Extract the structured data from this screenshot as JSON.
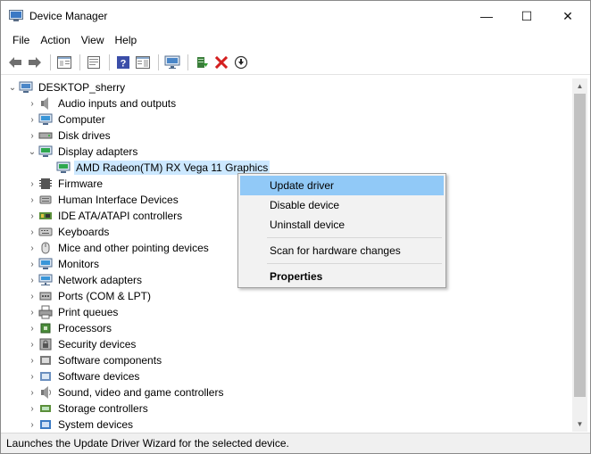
{
  "window": {
    "title": "Device Manager",
    "min_glyph": "—",
    "max_glyph": "☐",
    "close_glyph": "✕"
  },
  "menubar": [
    "File",
    "Action",
    "View",
    "Help"
  ],
  "toolbar": {
    "buttons": [
      "back-icon",
      "forward-icon",
      "console-tree-icon",
      "properties-page-icon",
      "help-icon",
      "action-pane-icon",
      "monitor-icon",
      "update-driver-icon",
      "uninstall-icon",
      "download-icon"
    ]
  },
  "tree": {
    "root": "DESKTOP_sherry",
    "items": [
      {
        "label": "Audio inputs and outputs",
        "icon": "speaker-icon",
        "expander": "›"
      },
      {
        "label": "Computer",
        "icon": "computer-icon",
        "expander": "›"
      },
      {
        "label": "Disk drives",
        "icon": "disk-icon",
        "expander": "›"
      },
      {
        "label": "Display adapters",
        "icon": "display-icon",
        "expander": "⌄",
        "children": [
          {
            "label": "AMD Radeon(TM) RX Vega 11 Graphics",
            "icon": "display-adapter-icon"
          }
        ]
      },
      {
        "label": "Firmware",
        "icon": "firmware-icon",
        "expander": "›"
      },
      {
        "label": "Human Interface Devices",
        "icon": "hid-icon",
        "expander": "›"
      },
      {
        "label": "IDE ATA/ATAPI controllers",
        "icon": "ide-icon",
        "expander": "›"
      },
      {
        "label": "Keyboards",
        "icon": "keyboard-icon",
        "expander": "›"
      },
      {
        "label": "Mice and other pointing devices",
        "icon": "mouse-icon",
        "expander": "›"
      },
      {
        "label": "Monitors",
        "icon": "monitor-icon",
        "expander": "›"
      },
      {
        "label": "Network adapters",
        "icon": "network-icon",
        "expander": "›"
      },
      {
        "label": "Ports (COM & LPT)",
        "icon": "port-icon",
        "expander": "›"
      },
      {
        "label": "Print queues",
        "icon": "printer-icon",
        "expander": "›"
      },
      {
        "label": "Processors",
        "icon": "processor-icon",
        "expander": "›"
      },
      {
        "label": "Security devices",
        "icon": "security-icon",
        "expander": "›"
      },
      {
        "label": "Software components",
        "icon": "software-component-icon",
        "expander": "›"
      },
      {
        "label": "Software devices",
        "icon": "software-device-icon",
        "expander": "›"
      },
      {
        "label": "Sound, video and game controllers",
        "icon": "sound-icon",
        "expander": "›"
      },
      {
        "label": "Storage controllers",
        "icon": "storage-icon",
        "expander": "›"
      },
      {
        "label": "System devices",
        "icon": "system-icon",
        "expander": "›"
      }
    ]
  },
  "context_menu": {
    "update": "Update driver",
    "disable": "Disable device",
    "uninstall": "Uninstall device",
    "scan": "Scan for hardware changes",
    "properties": "Properties"
  },
  "status": "Launches the Update Driver Wizard for the selected device.",
  "colors": {
    "selection": "#cce8ff",
    "menu_highlight": "#91c9f7"
  }
}
